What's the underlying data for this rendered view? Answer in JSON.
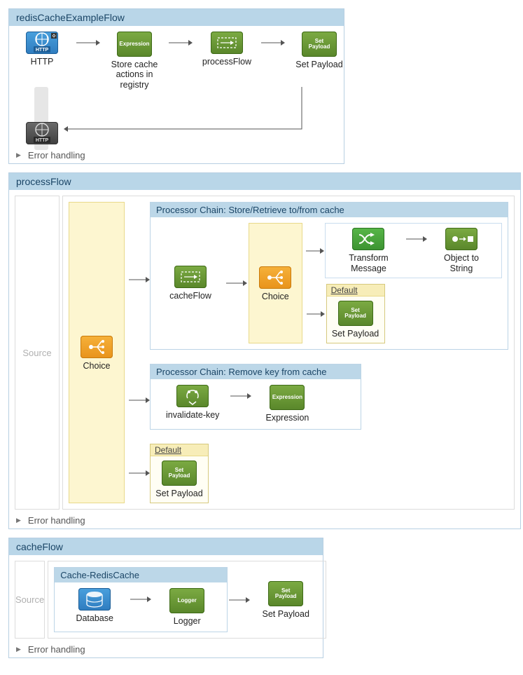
{
  "flow1": {
    "title": "redisCacheExampleFlow",
    "http_in": "HTTP",
    "store": "Store cache actions in registry",
    "process": "processFlow",
    "setp": "Set Payload",
    "err": "Error handling"
  },
  "flow2": {
    "title": "processFlow",
    "source": "Source",
    "choice": "Choice",
    "chain1_title": "Processor Chain: Store/Retrieve to/from cache",
    "cacheflow": "cacheFlow",
    "choice2": "Choice",
    "transform": "Transform Message",
    "obj2str": "Object to String",
    "default": "Default",
    "setp": "Set Payload",
    "chain2_title": "Processor Chain: Remove key from cache",
    "inval": "invalidate-key",
    "expr": "Expression",
    "err": "Error handling"
  },
  "flow3": {
    "title": "cacheFlow",
    "source": "Source",
    "scope_title": "Cache-RedisCache",
    "db": "Database",
    "logger": "Logger",
    "setp": "Set Payload",
    "err": "Error handling"
  },
  "icon_text": {
    "http": "HTTP",
    "expr": "Expression",
    "setp": "Set\nPayload",
    "logger": "Logger"
  }
}
